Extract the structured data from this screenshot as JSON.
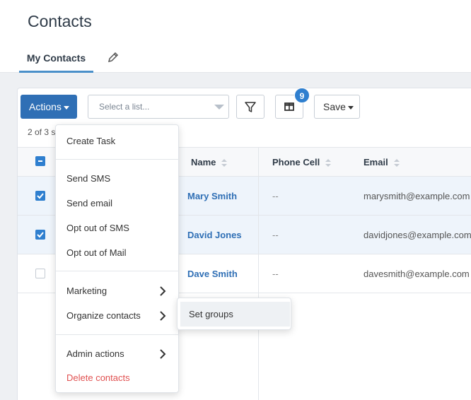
{
  "header": {
    "title": "Contacts",
    "tabs": [
      {
        "label": "My Contacts",
        "active": true
      }
    ]
  },
  "toolbar": {
    "actions_label": "Actions",
    "list_select": {
      "placeholder": "Select a list..."
    },
    "columns_badge": "9",
    "save_label": "Save"
  },
  "selection_text": "2 of 3 se",
  "table": {
    "columns": [
      "Name",
      "Phone Cell",
      "Email"
    ],
    "rows": [
      {
        "name": "Mary Smith",
        "phone": "--",
        "email": "marysmith@example.com",
        "checked": true
      },
      {
        "name": "David Jones",
        "phone": "--",
        "email": "davidjones@example.com",
        "checked": true
      },
      {
        "name": "Dave Smith",
        "phone": "--",
        "email": "davesmith@example.com",
        "checked": false
      }
    ]
  },
  "actions_menu": {
    "items": [
      {
        "label": "Create Task"
      },
      {
        "label": "Send SMS"
      },
      {
        "label": "Send email"
      },
      {
        "label": "Opt out of SMS"
      },
      {
        "label": "Opt out of Mail"
      },
      {
        "label": "Marketing",
        "submenu": true
      },
      {
        "label": "Organize contacts",
        "submenu": true
      },
      {
        "label": "Admin actions",
        "submenu": true
      },
      {
        "label": "Delete contacts",
        "danger": true
      }
    ]
  },
  "organize_submenu": {
    "items": [
      {
        "label": "Set groups"
      }
    ]
  },
  "colors": {
    "primary": "#2f6fb5",
    "badge": "#2f7fcf",
    "danger": "#e05050",
    "selected_row": "#eef4fb"
  },
  "icons": [
    "pencil-icon",
    "filter-icon",
    "columns-icon",
    "chevron-right-icon",
    "checkbox-icon"
  ]
}
